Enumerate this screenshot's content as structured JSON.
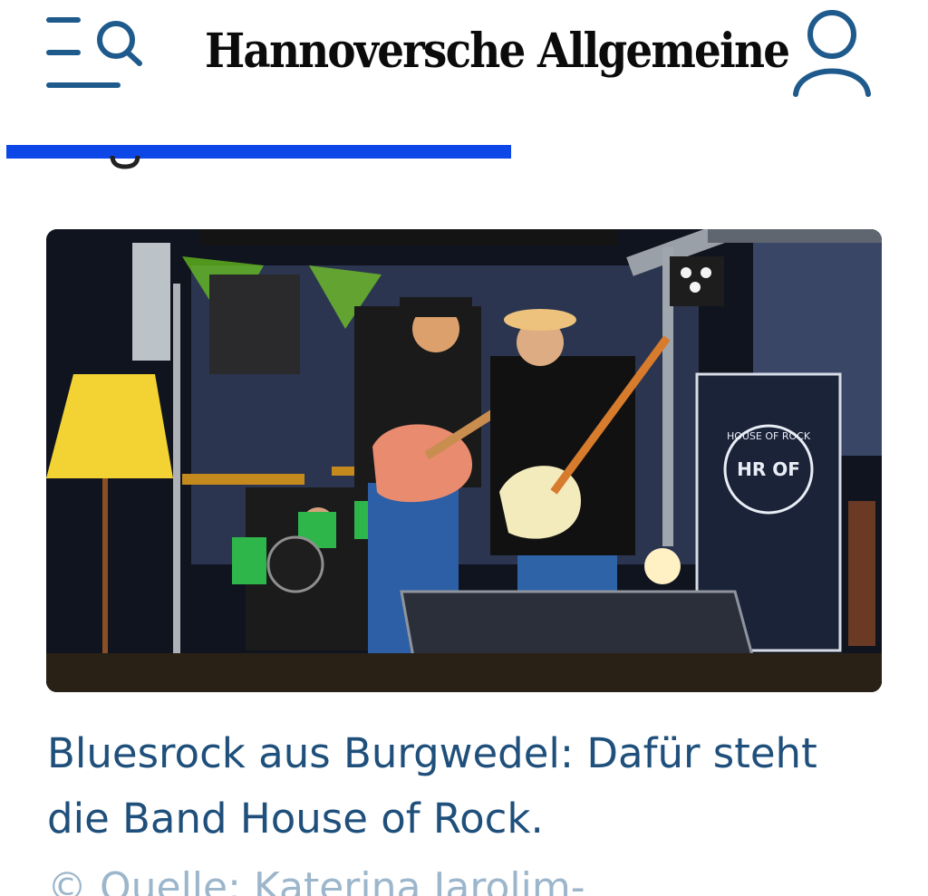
{
  "header": {
    "logo_text": "Hannoversche Allgemeine",
    "menu_icon": "menu-search-icon",
    "account_icon": "user-icon"
  },
  "colors": {
    "progress": "#0d47e8",
    "headline": "#1f4f7b",
    "source": "#9cb6cc",
    "icon": "#1f5a8c"
  },
  "article": {
    "headline": "Bluesrock aus Burgwedel: Dafür steht die Band House of Rock.",
    "image_banner_text": "HOUSE OF ROCK",
    "image_banner_logo": "HR OF",
    "source": "© Quelle: Katerina Jarolim-"
  }
}
